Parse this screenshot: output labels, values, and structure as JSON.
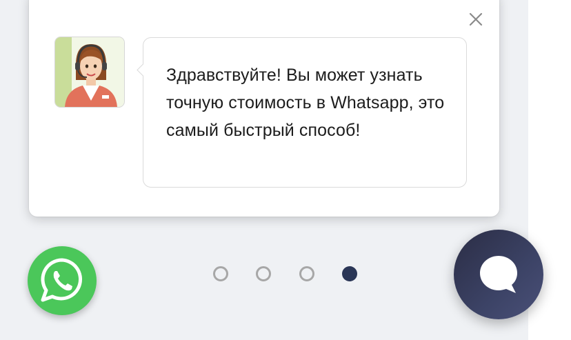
{
  "popup": {
    "message": "Здравствуйте! Вы может узнать точную стоимость в Whatsapp, это самый быстрый способ!",
    "avatar_icon": "operator-avatar",
    "close_icon": "close-icon"
  },
  "carousel": {
    "total_dots": 4,
    "active_index": 3
  },
  "buttons": {
    "whatsapp_icon": "whatsapp-icon",
    "chat_icon": "chat-bubble-icon"
  },
  "colors": {
    "whatsapp_green": "#4bc75a",
    "chat_button": "#3c4366",
    "dot_active": "#2a3656",
    "dot_inactive": "#a7a7a7",
    "page_background": "#eff1f4"
  }
}
